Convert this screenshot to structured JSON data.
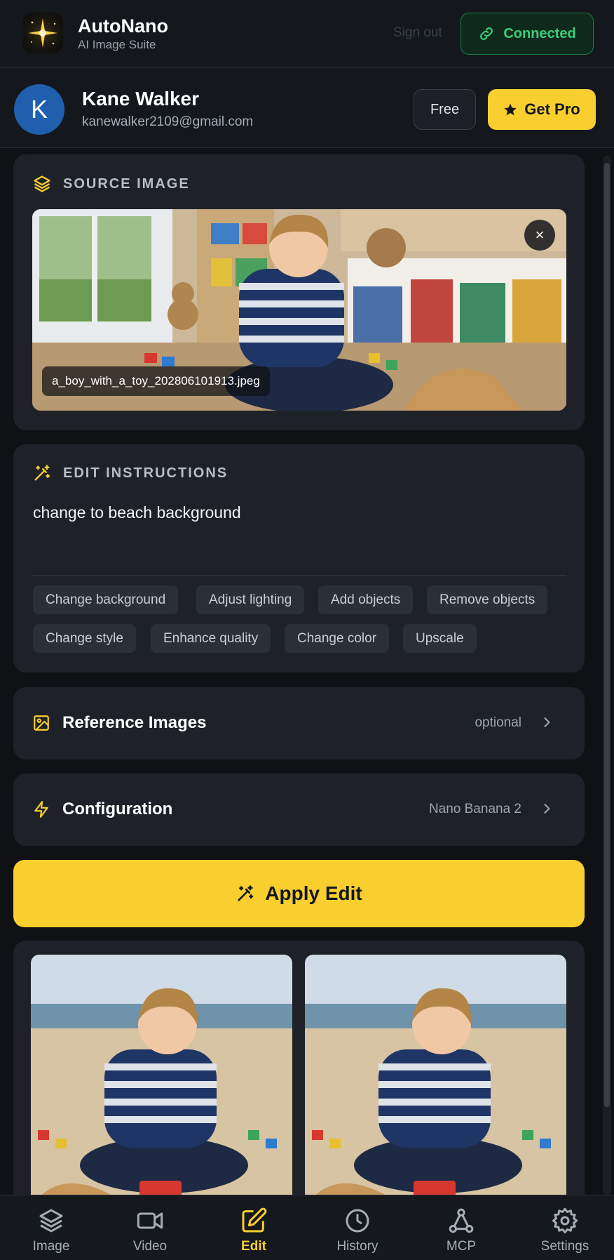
{
  "header": {
    "app_name": "AutoNano",
    "app_subtitle": "AI Image Suite",
    "signout_label": "Sign out",
    "connected_label": "Connected"
  },
  "user": {
    "initial": "K",
    "name": "Kane Walker",
    "email": "kanewalker2109@gmail.com",
    "plan_label": "Free",
    "upgrade_label": "Get Pro"
  },
  "source": {
    "heading": "SOURCE IMAGE",
    "filename": "a_boy_with_a_toy_202806101913.jpeg",
    "close_glyph": "×"
  },
  "edit": {
    "heading": "EDIT INSTRUCTIONS",
    "instruction": "change to beach background",
    "chips": [
      "Change background",
      "Adjust lighting",
      "Add objects",
      "Remove objects",
      "Change style",
      "Enhance quality",
      "Change color",
      "Upscale"
    ]
  },
  "reference": {
    "title": "Reference Images",
    "meta": "optional"
  },
  "configuration": {
    "title": "Configuration",
    "meta": "Nano Banana 2"
  },
  "apply_label": "Apply Edit",
  "nav": [
    {
      "label": "Image",
      "icon": "layers-icon"
    },
    {
      "label": "Video",
      "icon": "video-icon"
    },
    {
      "label": "Edit",
      "icon": "edit-icon"
    },
    {
      "label": "History",
      "icon": "clock-icon"
    },
    {
      "label": "MCP",
      "icon": "network-icon"
    },
    {
      "label": "Settings",
      "icon": "gear-icon"
    }
  ],
  "colors": {
    "accent": "#f8cf2f",
    "connected": "#3ad07b",
    "card": "#1e2228",
    "background": "#0f1114"
  }
}
